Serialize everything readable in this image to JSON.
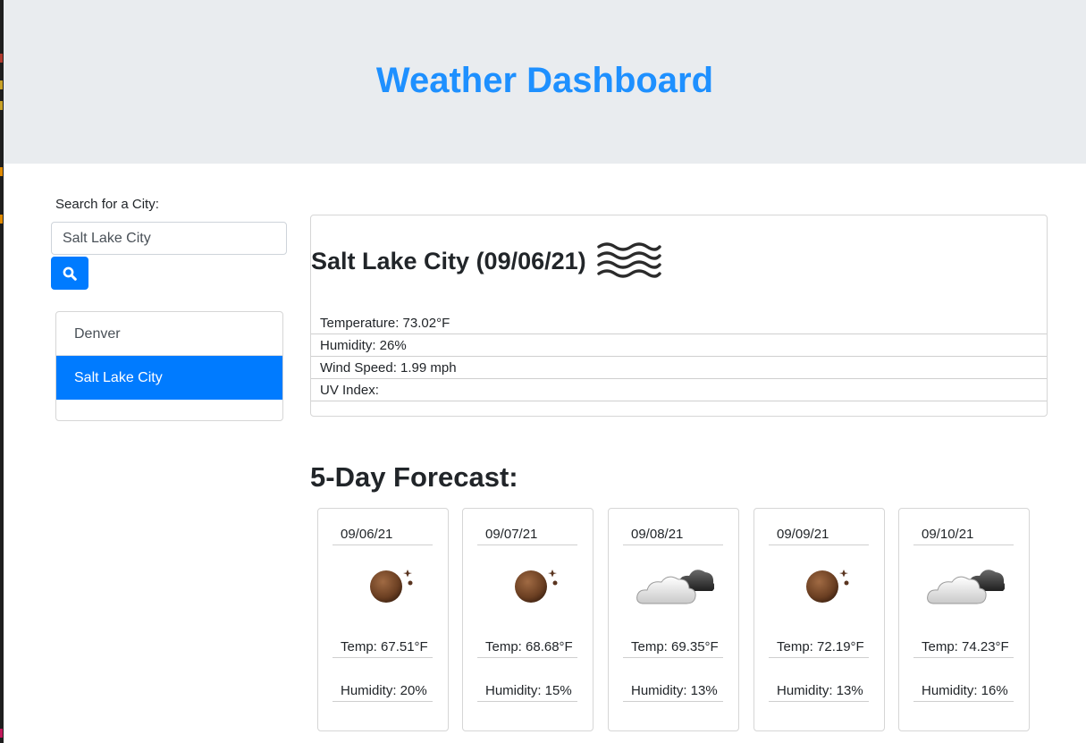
{
  "header": {
    "title": "Weather Dashboard"
  },
  "search": {
    "label": "Search for a City:",
    "value": "Salt Lake City",
    "button_icon": "search-icon"
  },
  "history": [
    {
      "label": "Denver",
      "active": false
    },
    {
      "label": "Salt Lake City",
      "active": true
    }
  ],
  "current": {
    "heading": "Salt Lake City (09/06/21)",
    "icon": "wind-haze-icon",
    "temperature": "Temperature: 73.02°F",
    "humidity": "Humidity: 26%",
    "wind": "Wind Speed: 1.99 mph",
    "uv": "UV Index:"
  },
  "forecast": {
    "heading": "5-Day Forecast:",
    "days": [
      {
        "date": "09/06/21",
        "icon": "clear-night-icon",
        "temp": "Temp: 67.51°F",
        "humidity": "Humidity: 20%"
      },
      {
        "date": "09/07/21",
        "icon": "clear-night-icon",
        "temp": "Temp: 68.68°F",
        "humidity": "Humidity: 15%"
      },
      {
        "date": "09/08/21",
        "icon": "clouds-icon",
        "temp": "Temp: 69.35°F",
        "humidity": "Humidity: 13%"
      },
      {
        "date": "09/09/21",
        "icon": "clear-night-icon",
        "temp": "Temp: 72.19°F",
        "humidity": "Humidity: 13%"
      },
      {
        "date": "09/10/21",
        "icon": "clouds-icon",
        "temp": "Temp: 74.23°F",
        "humidity": "Humidity: 16%"
      }
    ]
  },
  "colors": {
    "accent": "#007bff",
    "title": "#1e90ff",
    "header_bg": "#e9ecef"
  }
}
